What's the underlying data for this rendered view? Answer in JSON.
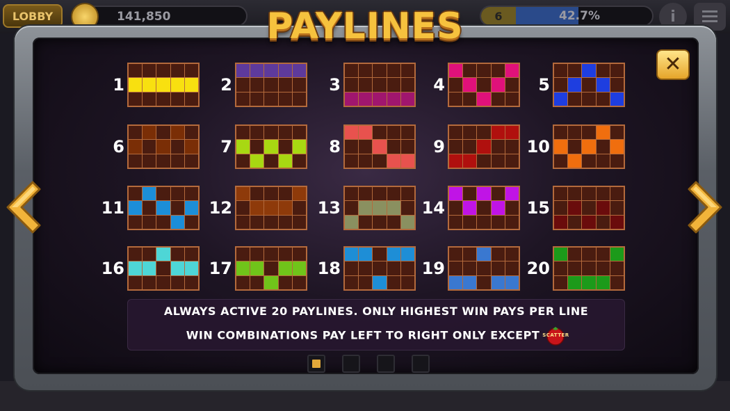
{
  "header": {
    "lobby_label": "LOBBY",
    "coins": "141,850",
    "level": "6",
    "level_progress": "42.7%",
    "info_label": "i"
  },
  "title": "PAYLINES",
  "close_label": "✕",
  "colors": {
    "grid_bg": "#4a1c10",
    "grid_line": "#b46a3c"
  },
  "paylines": [
    {
      "num": "1",
      "color": "#f8e010",
      "rows": [
        1,
        1,
        1,
        1,
        1
      ]
    },
    {
      "num": "2",
      "color": "#5e3a9c",
      "rows": [
        0,
        0,
        0,
        0,
        0
      ]
    },
    {
      "num": "3",
      "color": "#a0166e",
      "rows": [
        2,
        2,
        2,
        2,
        2
      ]
    },
    {
      "num": "4",
      "color": "#e0117a",
      "rows": [
        0,
        1,
        2,
        1,
        0
      ]
    },
    {
      "num": "5",
      "color": "#1e3ee0",
      "rows": [
        2,
        1,
        0,
        1,
        2
      ]
    },
    {
      "num": "6",
      "color": "#7a2e06",
      "rows": [
        1,
        0,
        1,
        0,
        1
      ]
    },
    {
      "num": "7",
      "color": "#a8d812",
      "rows": [
        1,
        2,
        1,
        2,
        1
      ]
    },
    {
      "num": "8",
      "color": "#e8524e",
      "rows": [
        0,
        0,
        1,
        2,
        2
      ]
    },
    {
      "num": "9",
      "color": "#b0100e",
      "rows": [
        2,
        2,
        1,
        0,
        0
      ]
    },
    {
      "num": "10",
      "color": "#f06e0e",
      "rows": [
        1,
        2,
        1,
        0,
        1
      ]
    },
    {
      "num": "11",
      "color": "#1c8ed8",
      "rows": [
        1,
        0,
        1,
        2,
        1
      ]
    },
    {
      "num": "12",
      "color": "#8e3a0a",
      "rows": [
        0,
        1,
        1,
        1,
        0
      ]
    },
    {
      "num": "13",
      "color": "#8a9060",
      "rows": [
        2,
        1,
        1,
        1,
        2
      ]
    },
    {
      "num": "14",
      "color": "#c014e6",
      "rows": [
        0,
        1,
        0,
        1,
        0
      ]
    },
    {
      "num": "15",
      "color": "#6a0c0c",
      "rows": [
        2,
        1,
        2,
        1,
        2
      ]
    },
    {
      "num": "16",
      "color": "#4ed6d6",
      "rows": [
        1,
        1,
        0,
        1,
        1
      ]
    },
    {
      "num": "17",
      "color": "#70c41a",
      "rows": [
        1,
        1,
        2,
        1,
        1
      ]
    },
    {
      "num": "18",
      "color": "#1e8ed6",
      "rows": [
        0,
        0,
        2,
        0,
        0
      ]
    },
    {
      "num": "19",
      "color": "#3a78d0",
      "rows": [
        2,
        2,
        0,
        2,
        2
      ]
    },
    {
      "num": "20",
      "color": "#1c9a1a",
      "rows": [
        0,
        2,
        2,
        2,
        0
      ]
    }
  ],
  "info": {
    "line1": "ALWAYS ACTIVE 20 PAYLINES. ONLY HIGHEST WIN PAYS PER LINE",
    "line2": "WIN COMBINATIONS PAY LEFT TO RIGHT ONLY EXCEPT",
    "scatter_label": "SCATTER"
  },
  "pager": {
    "count": 4,
    "active": 0
  }
}
